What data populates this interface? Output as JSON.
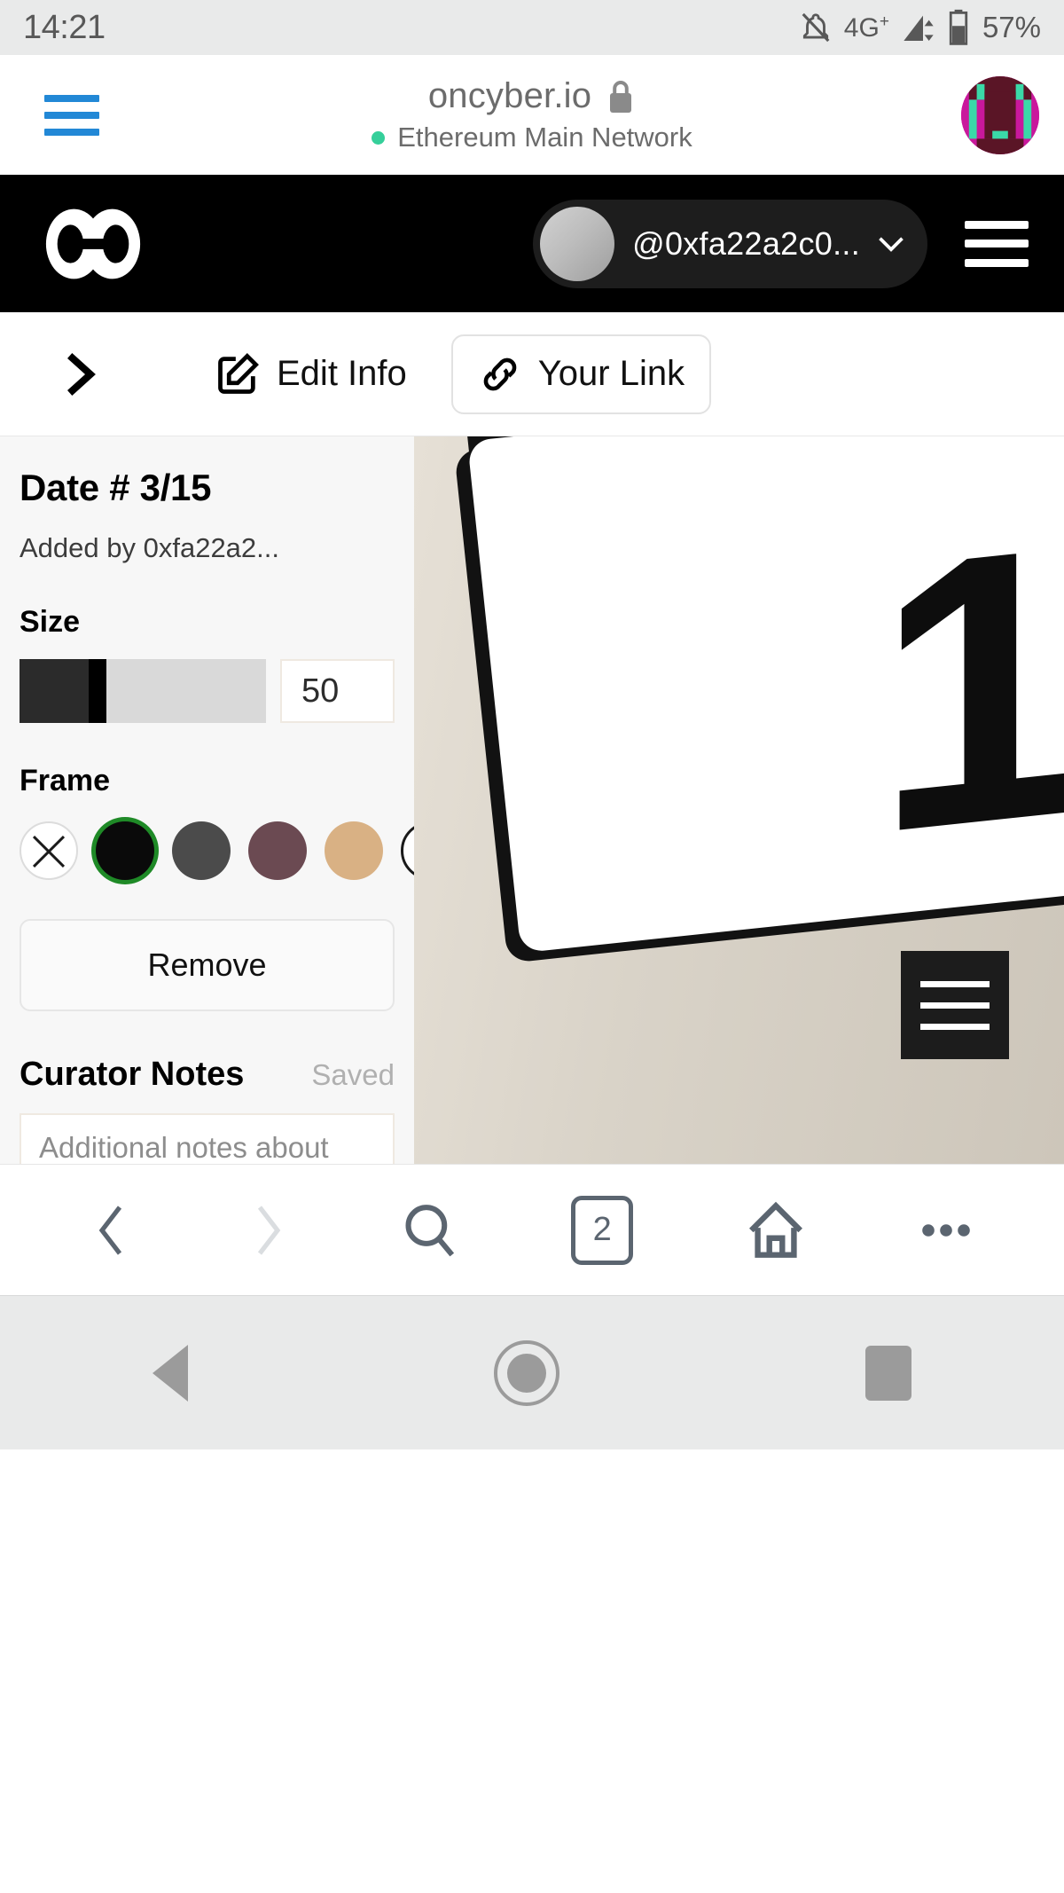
{
  "status_bar": {
    "time": "14:21",
    "network_type": "4G",
    "network_plus": "+",
    "battery_percent": "57%",
    "icons": [
      "bell-muted-icon",
      "signal-bars-icon",
      "battery-icon"
    ]
  },
  "browser": {
    "url_host": "oncyber.io",
    "lock_icon": "lock-icon",
    "network_label": "Ethereum Main Network",
    "network_dot_color": "#35cf9a",
    "menu_icon": "hamburger-menu-icon",
    "menu_color": "#2288d6",
    "profile_avatar": "pixel-avatar-icon"
  },
  "app_header": {
    "logo": "oncyber-infinity-logo",
    "account_name": "@0xfa22a2c0...",
    "account_chevron": "chevron-down-icon",
    "menu_icon": "hamburger-menu-icon",
    "background": "#000000"
  },
  "toolbar": {
    "collapse_icon": "chevron-right-icon",
    "edit_label": "Edit Info",
    "edit_icon": "edit-square-pencil-icon",
    "link_label": "Your Link",
    "link_icon": "chain-link-icon"
  },
  "panel": {
    "title": "Date # 3/15",
    "added_by": "Added by 0xfa22a2...",
    "size_label": "Size",
    "size_value": "50",
    "frame_label": "Frame",
    "frame_swatches": [
      {
        "name": "none",
        "color": "#ffffff",
        "selected": false
      },
      {
        "name": "black",
        "color": "#0a0a0a",
        "selected": true
      },
      {
        "name": "dark-gray",
        "color": "#4b4b4b",
        "selected": false
      },
      {
        "name": "mauve",
        "color": "#6b4a52",
        "selected": false
      },
      {
        "name": "tan",
        "color": "#d9b184",
        "selected": false
      },
      {
        "name": "custom",
        "color": "#ffffff",
        "selected": false
      }
    ],
    "selection_ring_color": "#1f8a27",
    "remove_label": "Remove",
    "notes_title": "Curator Notes",
    "notes_status": "Saved",
    "notes_placeholder": "Additional notes about the artwork"
  },
  "artwork": {
    "description": "close-up photo of a white card with a large black number 1",
    "number": "1",
    "overlay_icon": "hamburger-menu-icon"
  },
  "bottom_nav": {
    "back_icon": "chevron-back-icon",
    "forward_icon": "chevron-forward-icon",
    "search_icon": "search-icon",
    "tab_count": "2",
    "home_icon": "home-icon",
    "more_icon": "more-horizontal-icon"
  },
  "android_nav": {
    "back_icon": "triangle-back-icon",
    "home_icon": "circle-home-icon",
    "recents_icon": "square-recents-icon"
  }
}
